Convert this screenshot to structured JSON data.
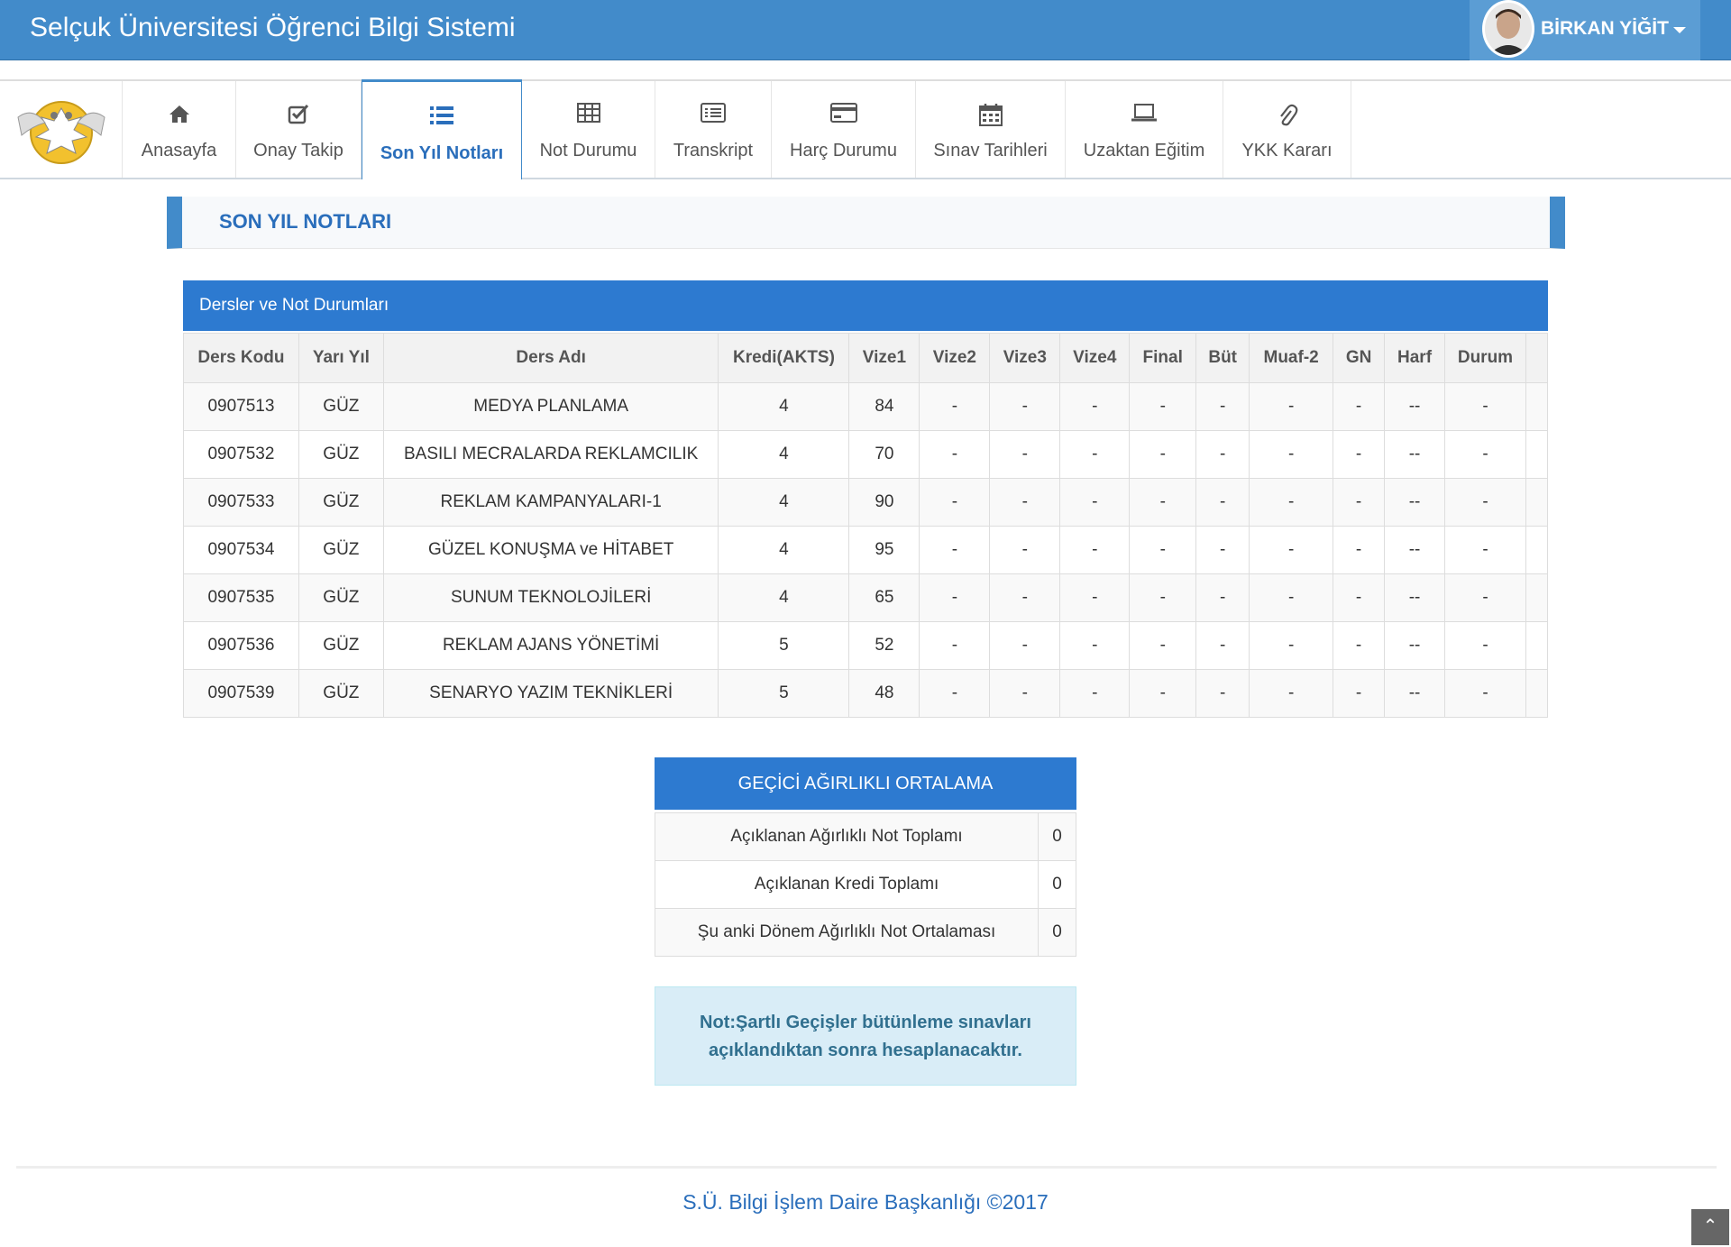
{
  "header": {
    "title": "Selçuk Üniversitesi Öğrenci Bilgi Sistemi",
    "user_name": "BİRKAN YİĞİT"
  },
  "nav": {
    "items": [
      {
        "label": "Anasayfa",
        "icon": "home-icon"
      },
      {
        "label": "Onay Takip",
        "icon": "check-square-icon"
      },
      {
        "label": "Son Yıl Notları",
        "icon": "list-icon"
      },
      {
        "label": "Not Durumu",
        "icon": "table-icon"
      },
      {
        "label": "Transkript",
        "icon": "list-alt-icon"
      },
      {
        "label": "Harç Durumu",
        "icon": "credit-card-icon"
      },
      {
        "label": "Sınav Tarihleri",
        "icon": "calendar-icon"
      },
      {
        "label": "Uzaktan Eğitim",
        "icon": "laptop-icon"
      },
      {
        "label": "YKK Kararı",
        "icon": "paperclip-icon"
      }
    ],
    "active_index": 2
  },
  "page_title": "SON YIL NOTLARI",
  "grades_panel": {
    "title": "Dersler ve Not Durumları",
    "columns": [
      "Ders Kodu",
      "Yarı Yıl",
      "Ders Adı",
      "Kredi(AKTS)",
      "Vize1",
      "Vize2",
      "Vize3",
      "Vize4",
      "Final",
      "Büt",
      "Muaf-2",
      "GN",
      "Harf",
      "Durum"
    ],
    "rows": [
      [
        "0907513",
        "GÜZ",
        "MEDYA PLANLAMA",
        "4",
        "84",
        "-",
        "-",
        "-",
        "-",
        "-",
        "-",
        "-",
        "--",
        "-"
      ],
      [
        "0907532",
        "GÜZ",
        "BASILI MECRALARDA REKLAMCILIK",
        "4",
        "70",
        "-",
        "-",
        "-",
        "-",
        "-",
        "-",
        "-",
        "--",
        "-"
      ],
      [
        "0907533",
        "GÜZ",
        "REKLAM KAMPANYALARI-1",
        "4",
        "90",
        "-",
        "-",
        "-",
        "-",
        "-",
        "-",
        "-",
        "--",
        "-"
      ],
      [
        "0907534",
        "GÜZ",
        "GÜZEL KONUŞMA ve HİTABET",
        "4",
        "95",
        "-",
        "-",
        "-",
        "-",
        "-",
        "-",
        "-",
        "--",
        "-"
      ],
      [
        "0907535",
        "GÜZ",
        "SUNUM TEKNOLOJİLERİ",
        "4",
        "65",
        "-",
        "-",
        "-",
        "-",
        "-",
        "-",
        "-",
        "--",
        "-"
      ],
      [
        "0907536",
        "GÜZ",
        "REKLAM AJANS YÖNETİMİ",
        "5",
        "52",
        "-",
        "-",
        "-",
        "-",
        "-",
        "-",
        "-",
        "--",
        "-"
      ],
      [
        "0907539",
        "GÜZ",
        "SENARYO YAZIM TEKNİKLERİ",
        "5",
        "48",
        "-",
        "-",
        "-",
        "-",
        "-",
        "-",
        "-",
        "--",
        "-"
      ]
    ]
  },
  "gano": {
    "title": "GEÇİCİ AĞIRLIKLI ORTALAMA",
    "rows": [
      {
        "label": "Açıklanan Ağırlıklı Not Toplamı",
        "value": "0"
      },
      {
        "label": "Açıklanan Kredi Toplamı",
        "value": "0"
      },
      {
        "label": "Şu anki Dönem Ağırlıklı Not Ortalaması",
        "value": "0"
      }
    ]
  },
  "note": {
    "line1": "Not:Şartlı Geçişler bütünleme sınavları",
    "line2": "açıklandıktan sonra hesaplanacaktır."
  },
  "footer": "S.Ü. Bilgi İşlem Daire Başkanlığı ©2017",
  "colors": {
    "primary": "#428bca",
    "panel_head": "#2d7ad0",
    "note_bg": "#d9edf7",
    "note_text": "#31708f"
  }
}
